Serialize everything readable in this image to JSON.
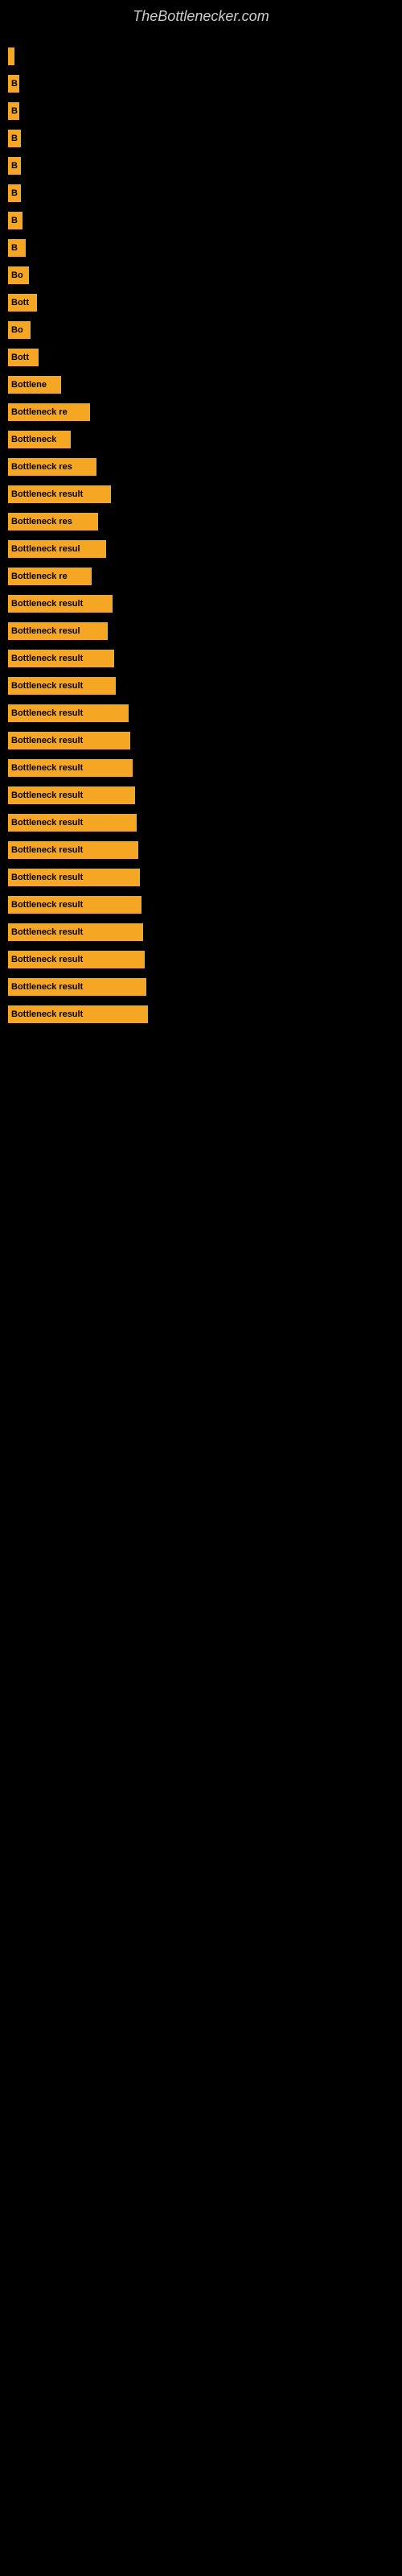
{
  "site": {
    "title": "TheBottlenecker.com"
  },
  "bars": [
    {
      "label": "",
      "width": 8
    },
    {
      "label": "B",
      "width": 14
    },
    {
      "label": "B",
      "width": 14
    },
    {
      "label": "B",
      "width": 16
    },
    {
      "label": "B",
      "width": 16
    },
    {
      "label": "B",
      "width": 16
    },
    {
      "label": "B",
      "width": 18
    },
    {
      "label": "B",
      "width": 22
    },
    {
      "label": "Bo",
      "width": 26
    },
    {
      "label": "Bott",
      "width": 36
    },
    {
      "label": "Bo",
      "width": 28
    },
    {
      "label": "Bott",
      "width": 38
    },
    {
      "label": "Bottlene",
      "width": 66
    },
    {
      "label": "Bottleneck re",
      "width": 102
    },
    {
      "label": "Bottleneck",
      "width": 78
    },
    {
      "label": "Bottleneck res",
      "width": 110
    },
    {
      "label": "Bottleneck result",
      "width": 128
    },
    {
      "label": "Bottleneck res",
      "width": 112
    },
    {
      "label": "Bottleneck resul",
      "width": 122
    },
    {
      "label": "Bottleneck re",
      "width": 104
    },
    {
      "label": "Bottleneck result",
      "width": 130
    },
    {
      "label": "Bottleneck resul",
      "width": 124
    },
    {
      "label": "Bottleneck result",
      "width": 132
    },
    {
      "label": "Bottleneck result",
      "width": 134
    },
    {
      "label": "Bottleneck result",
      "width": 150
    },
    {
      "label": "Bottleneck result",
      "width": 152
    },
    {
      "label": "Bottleneck result",
      "width": 155
    },
    {
      "label": "Bottleneck result",
      "width": 158
    },
    {
      "label": "Bottleneck result",
      "width": 160
    },
    {
      "label": "Bottleneck result",
      "width": 162
    },
    {
      "label": "Bottleneck result",
      "width": 164
    },
    {
      "label": "Bottleneck result",
      "width": 166
    },
    {
      "label": "Bottleneck result",
      "width": 168
    },
    {
      "label": "Bottleneck result",
      "width": 170
    },
    {
      "label": "Bottleneck result",
      "width": 172
    },
    {
      "label": "Bottleneck result",
      "width": 174
    }
  ]
}
